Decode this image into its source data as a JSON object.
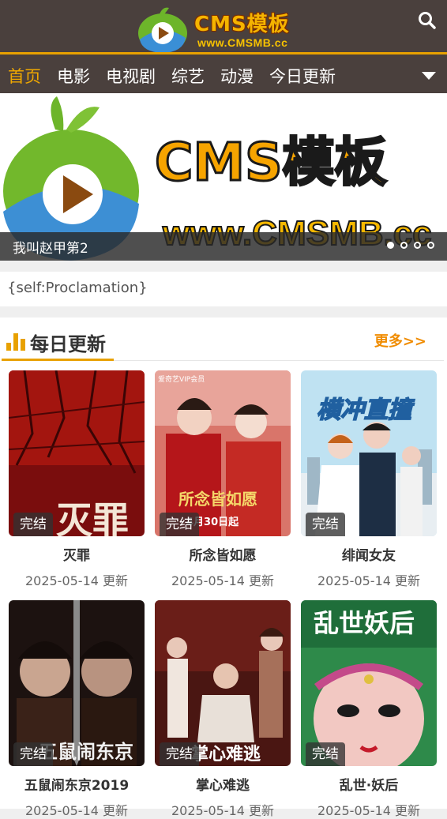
{
  "header": {
    "logo_title": "CMS模板",
    "logo_url": "www.CMSMB.cc"
  },
  "nav": {
    "items": [
      {
        "label": "首页",
        "active": true
      },
      {
        "label": "电影"
      },
      {
        "label": "电视剧"
      },
      {
        "label": "综艺"
      },
      {
        "label": "动漫"
      },
      {
        "label": "今日更新"
      }
    ]
  },
  "banner": {
    "art_title": "CMS模板",
    "art_url": "www.CMSMB.cc",
    "caption": "我叫赵甲第2",
    "slide_count": 4,
    "active_slide": 1
  },
  "notice": {
    "text": "{self:Proclamation}"
  },
  "section": {
    "title": "每日更新",
    "more_label": "更多>>",
    "cards": [
      {
        "title": "灭罪",
        "date": "2025-05-14 更新",
        "badge": "完结"
      },
      {
        "title": "所念皆如愿",
        "date": "2025-05-14 更新",
        "badge": "完结"
      },
      {
        "title": "绯闻女友",
        "date": "2025-05-14 更新",
        "badge": "完结"
      },
      {
        "title": "五鼠闹东京2019",
        "date": "2025-05-14 更新",
        "badge": "完结"
      },
      {
        "title": "掌心难逃",
        "date": "2025-05-14 更新",
        "badge": "完结"
      },
      {
        "title": "乱世·妖后",
        "date": "2025-05-14 更新",
        "badge": "完结"
      }
    ],
    "poster_texts": {
      "p1": "灭罪",
      "p2_title": "所念皆如愿",
      "p2_date": "4月30日起",
      "p2_tag": "爱奇艺VIP会员",
      "p3": "横冲直撞",
      "p4": "五鼠闹东京",
      "p5": "掌心难逃",
      "p6": "乱世妖后"
    }
  },
  "colors": {
    "header_bg": "#4a403d",
    "accent": "#e8a100",
    "active_nav": "#f0a800",
    "more_link": "#f08c00"
  }
}
